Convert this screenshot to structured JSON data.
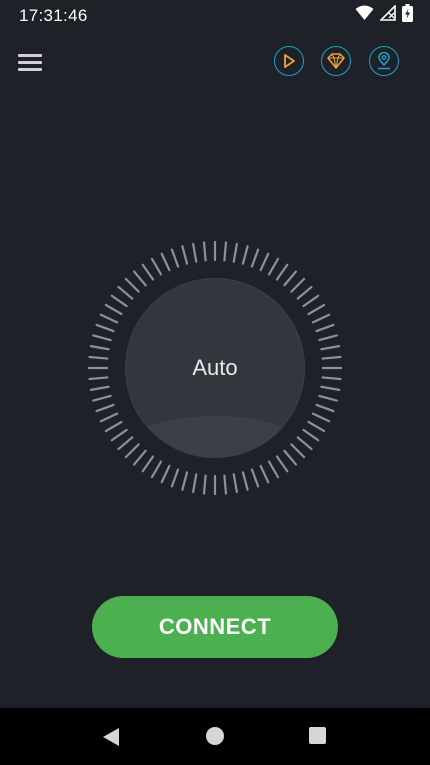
{
  "status_bar": {
    "time": "17:31:46",
    "icons": [
      "wifi-icon",
      "signal-icon",
      "battery-charging-icon"
    ]
  },
  "toolbar": {
    "menu_icon": "menu-icon",
    "actions": [
      "play-icon",
      "diamond-icon",
      "location-pin-icon"
    ]
  },
  "dial": {
    "server_label": "Auto"
  },
  "connect": {
    "label": "CONNECT"
  },
  "nav_bar": {
    "icons": [
      "back-icon",
      "home-icon",
      "recents-icon"
    ]
  },
  "colors": {
    "background": "#1f2128",
    "accent": "#1aa3c6",
    "premium": "#f0a23b",
    "connect_button": "#4caf50"
  }
}
